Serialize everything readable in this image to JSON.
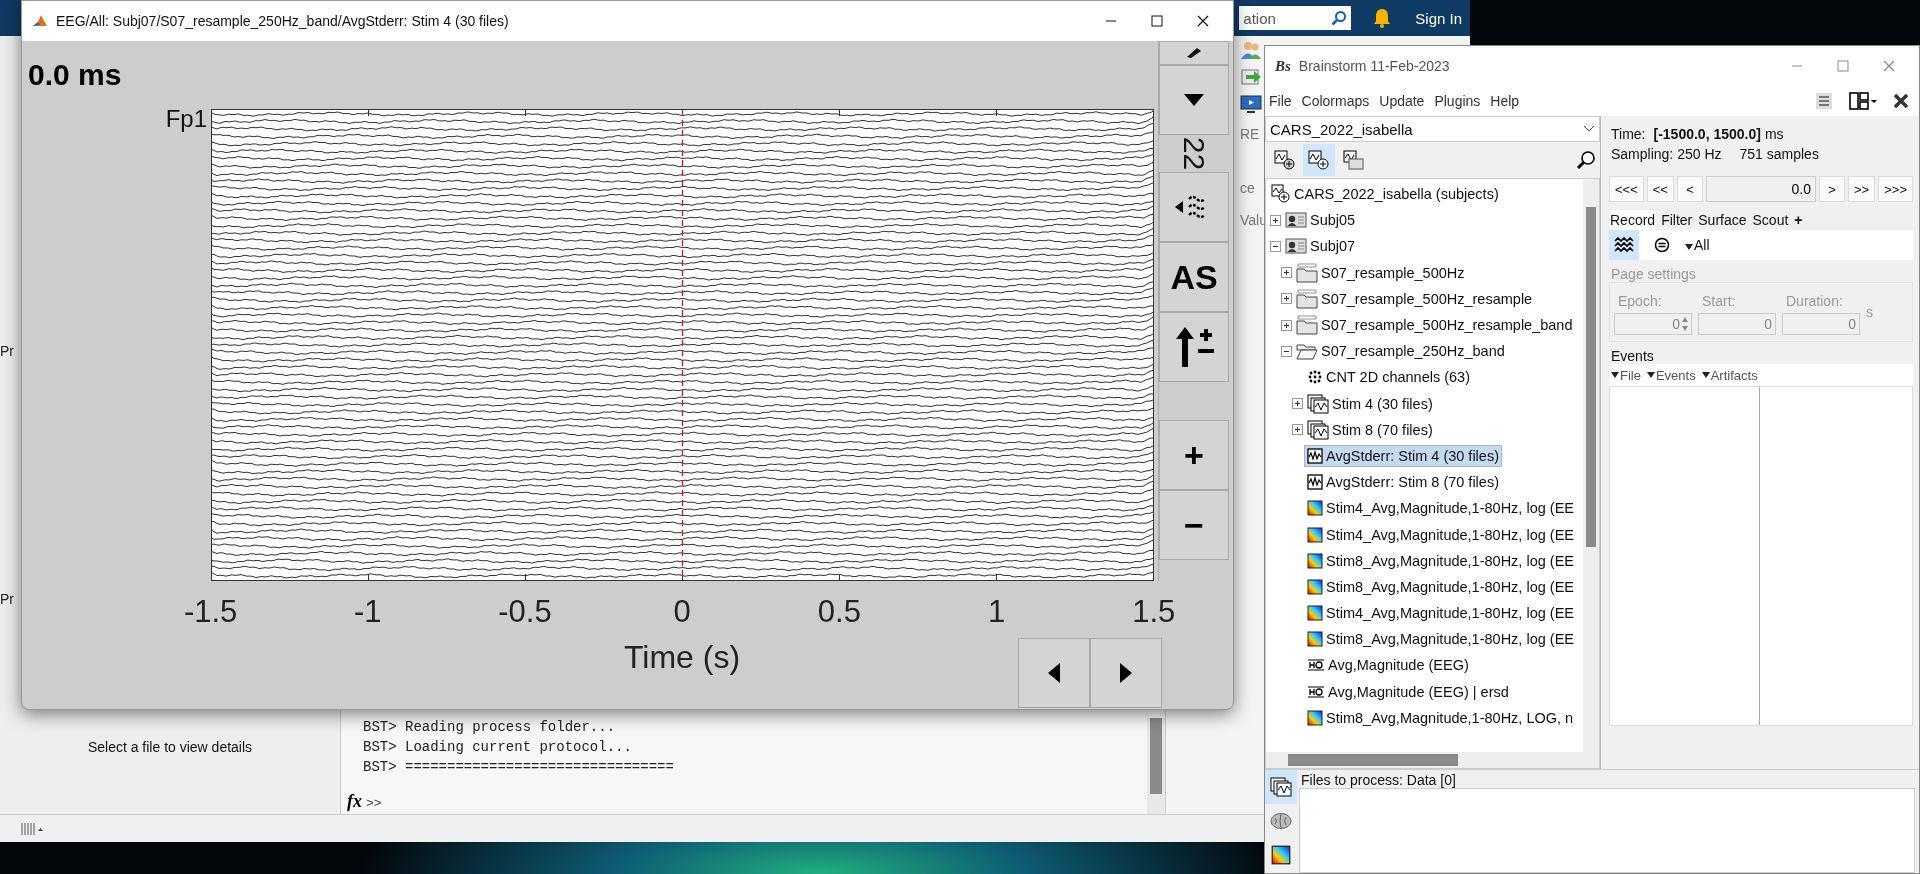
{
  "background_window": {
    "search_text": "ation",
    "sign_in": "Sign In",
    "toolstrip_label": "RE",
    "side_labels": [
      "ce",
      "Valu"
    ],
    "edge_labels": [
      "Pr",
      "Pr"
    ],
    "details_text": "Select a file to view details",
    "console_lines": [
      "BST> Reading process folder...",
      "BST> Loading current protocol...",
      "BST> ================================"
    ],
    "prompt_symbol": "fx",
    "prompt": ">>"
  },
  "eeg_window": {
    "title": "EEG/All: Subj07/S07_resample_250Hz_band/AvgStderr: Stim 4 (30 files)",
    "time_label": "0.0 ms",
    "channel_label": "Fp1",
    "x_ticks": [
      "-1.5",
      "-1",
      "-0.5",
      "0",
      "0.5",
      "1",
      "1.5"
    ],
    "xlabel": "Time (s)",
    "toolbar_top": [
      {
        "kind": "partial"
      },
      {
        "kind": "down"
      },
      {
        "kind": "label",
        "text": "22"
      }
    ],
    "toolbar_middle": [
      {
        "kind": "filter"
      },
      {
        "kind": "text",
        "text": "AS"
      },
      {
        "kind": "gain"
      }
    ],
    "toolbar_bottom": [
      {
        "kind": "text",
        "text": "+"
      },
      {
        "kind": "text",
        "text": "−"
      }
    ]
  },
  "brainstorm": {
    "logo": "Bs",
    "title": "Brainstorm 11-Feb-2023",
    "menu": [
      "File",
      "Colormaps",
      "Update",
      "Plugins",
      "Help"
    ],
    "protocol": "CARS_2022_isabella",
    "view_buttons": [
      {
        "selected": false
      },
      {
        "selected": true
      },
      {
        "selected": false
      }
    ],
    "tree": {
      "kind": "protocol",
      "label": "CARS_2022_isabella (subjects)",
      "selected": false,
      "children": [
        {
          "kind": "subject",
          "label": "Subj05",
          "expanded": false,
          "selected": false
        },
        {
          "kind": "subject",
          "label": "Subj07",
          "expanded": true,
          "selected": false,
          "children": [
            {
              "kind": "raw",
              "label": "S07_resample_500Hz",
              "expanded": false,
              "selected": false
            },
            {
              "kind": "raw",
              "label": "S07_resample_500Hz_resample",
              "expanded": false,
              "selected": false
            },
            {
              "kind": "raw",
              "label": "S07_resample_500Hz_resample_band",
              "expanded": false,
              "selected": false
            },
            {
              "kind": "folder",
              "label": "S07_resample_250Hz_band",
              "expanded": true,
              "selected": false,
              "children": [
                {
                  "kind": "channels",
                  "label": "CNT 2D channels (63)",
                  "selected": false
                },
                {
                  "kind": "group",
                  "label": "Stim 4 (30 files)",
                  "expanded": false,
                  "selected": false
                },
                {
                  "kind": "group",
                  "label": "Stim 8 (70 files)",
                  "expanded": false,
                  "selected": false
                },
                {
                  "kind": "data",
                  "label": "AvgStderr: Stim 4 (30 files)",
                  "selected": true
                },
                {
                  "kind": "data",
                  "label": "AvgStderr: Stim 8 (70 files)",
                  "selected": false
                },
                {
                  "kind": "timefreq",
                  "label": "Stim4_Avg,Magnitude,1-80Hz, log (EE",
                  "selected": false
                },
                {
                  "kind": "timefreq",
                  "label": "Stim4_Avg,Magnitude,1-80Hz, log (EE",
                  "selected": false
                },
                {
                  "kind": "timefreq",
                  "label": "Stim8_Avg,Magnitude,1-80Hz, log (EE",
                  "selected": false
                },
                {
                  "kind": "timefreq",
                  "label": "Stim8_Avg,Magnitude,1-80Hz, log (EE",
                  "selected": false
                },
                {
                  "kind": "timefreq",
                  "label": "Stim4_Avg,Magnitude,1-80Hz, log (EE",
                  "selected": false
                },
                {
                  "kind": "timefreq",
                  "label": "Stim8_Avg,Magnitude,1-80Hz, log (EE",
                  "selected": false
                },
                {
                  "kind": "header",
                  "label": "Avg,Magnitude (EEG)",
                  "selected": false
                },
                {
                  "kind": "header",
                  "label": "Avg,Magnitude (EEG) | ersd",
                  "selected": false
                },
                {
                  "kind": "timefreq",
                  "label": "Stim8_Avg,Magnitude,1-80Hz, LOG, n",
                  "selected": false
                }
              ]
            }
          ]
        }
      ]
    },
    "info": {
      "time_label": "Time:",
      "time_range": "[-1500.0, 1500.0]",
      "time_unit": "ms",
      "sampling": "Sampling: 250 Hz",
      "samples": "751 samples"
    },
    "time_nav": {
      "buttons_left": [
        "<<<",
        "<<",
        "<"
      ],
      "value": "0.0",
      "buttons_right": [
        ">",
        ">>",
        ">>>"
      ]
    },
    "tabs": [
      {
        "label": "Record",
        "selected": true
      },
      {
        "label": "Filter",
        "selected": false
      },
      {
        "label": "Surface",
        "selected": false
      },
      {
        "label": "Scout",
        "selected": false
      }
    ],
    "add_tab": "+",
    "record_tools": [
      {
        "kind": "waves",
        "selected": true
      },
      {
        "kind": "montage",
        "selected": false
      }
    ],
    "montage": "All",
    "page_settings": {
      "title": "Page settings",
      "disabled": true,
      "fields": [
        {
          "label": "Epoch:",
          "value": "0",
          "kind": "spinner"
        },
        {
          "label": "Start:",
          "value": "0",
          "kind": "plain"
        },
        {
          "label": "Duration:",
          "value": "0",
          "kind": "plain"
        }
      ],
      "unit": "s"
    },
    "events": {
      "title": "Events",
      "menus": [
        "File",
        "Events",
        "Artifacts"
      ]
    },
    "process": {
      "title": "Files to process: Data [0]",
      "tabs": [
        {
          "kind": "data",
          "selected": true
        },
        {
          "kind": "brain",
          "selected": false
        },
        {
          "kind": "timefreq",
          "selected": false
        }
      ]
    }
  }
}
